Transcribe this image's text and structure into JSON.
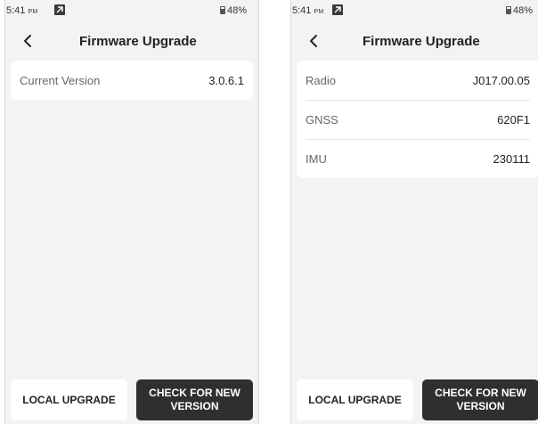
{
  "screens": [
    {
      "status": {
        "time": "5:41",
        "ampm": "PM",
        "battery": "48%"
      },
      "title": "Firmware Upgrade",
      "rows": [
        {
          "label": "Current Version",
          "value": "3.0.6.1"
        }
      ],
      "buttons": {
        "local": "LOCAL UPGRADE",
        "check": "CHECK FOR NEW VERSION"
      }
    },
    {
      "status": {
        "time": "5:41",
        "ampm": "PM",
        "battery": "48%"
      },
      "title": "Firmware Upgrade",
      "rows": [
        {
          "label": "Radio",
          "value": "J017.00.05"
        },
        {
          "label": "GNSS",
          "value": "620F1"
        },
        {
          "label": "IMU",
          "value": "230111"
        }
      ],
      "buttons": {
        "local": "LOCAL UPGRADE",
        "check": "CHECK FOR NEW VERSION"
      }
    }
  ],
  "icons": {
    "back": "chevron-left-icon",
    "app_badge": "app-notification-icon",
    "battery": "battery-icon"
  }
}
